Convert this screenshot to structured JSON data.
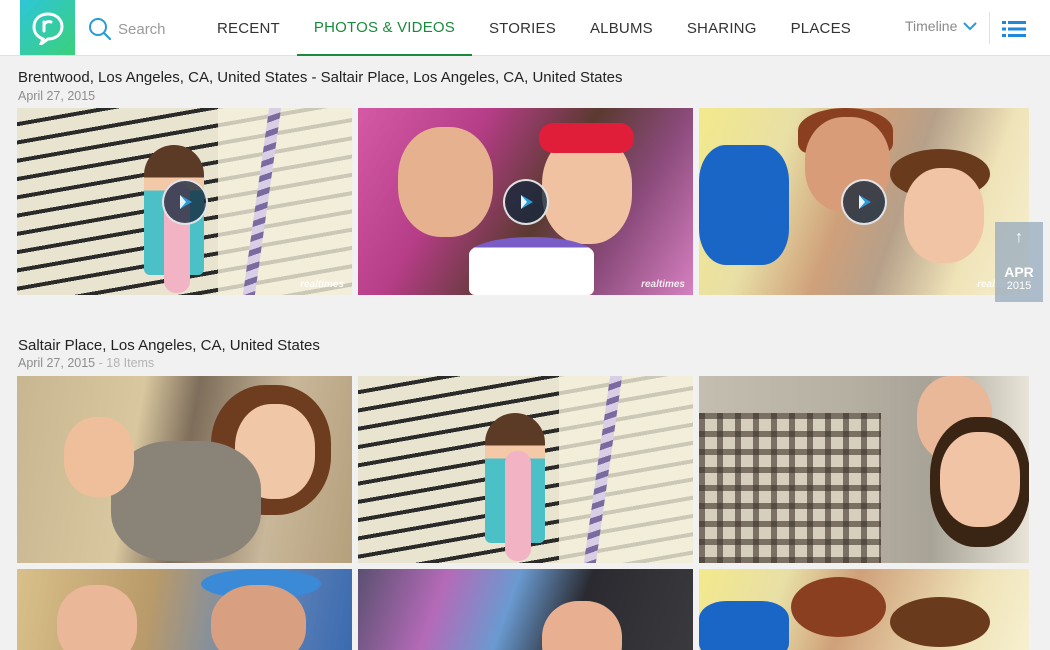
{
  "search": {
    "label": "Search"
  },
  "tabs": [
    {
      "label": "RECENT",
      "active": false
    },
    {
      "label": "PHOTOS & VIDEOS",
      "active": true
    },
    {
      "label": "STORIES",
      "active": false
    },
    {
      "label": "ALBUMS",
      "active": false
    },
    {
      "label": "SHARING",
      "active": false
    },
    {
      "label": "PLACES",
      "active": false
    }
  ],
  "view": {
    "timeline_label": "Timeline"
  },
  "colors": {
    "accent": "#1a8a3c",
    "logo_from": "#2ec6d8",
    "logo_to": "#3ad07a",
    "link": "#1f88d8"
  },
  "groups": [
    {
      "title": "Brentwood, Los Angeles, CA, United States - Saltair Place, Los Angeles, CA, United States",
      "date": "April 27, 2015",
      "count": "",
      "items": [
        {
          "type": "video",
          "scene": "stairs",
          "watermark": "realtimes"
        },
        {
          "type": "video",
          "scene": "cake",
          "watermark": "realtimes"
        },
        {
          "type": "video",
          "scene": "grandma",
          "watermark": "realtimes"
        }
      ]
    },
    {
      "title": "Saltair Place, Los Angeles, CA, United States",
      "date": "April 27, 2015",
      "count": " - 18 Items",
      "items": [
        {
          "type": "photo",
          "scene": "hug"
        },
        {
          "type": "photo",
          "scene": "stairs"
        },
        {
          "type": "photo",
          "scene": "plaid"
        },
        {
          "type": "photo",
          "scene": "party"
        },
        {
          "type": "photo",
          "scene": "blur"
        },
        {
          "type": "photo",
          "scene": "grandma2"
        }
      ]
    }
  ],
  "scrubber": {
    "month": "APR",
    "year": "2015"
  }
}
